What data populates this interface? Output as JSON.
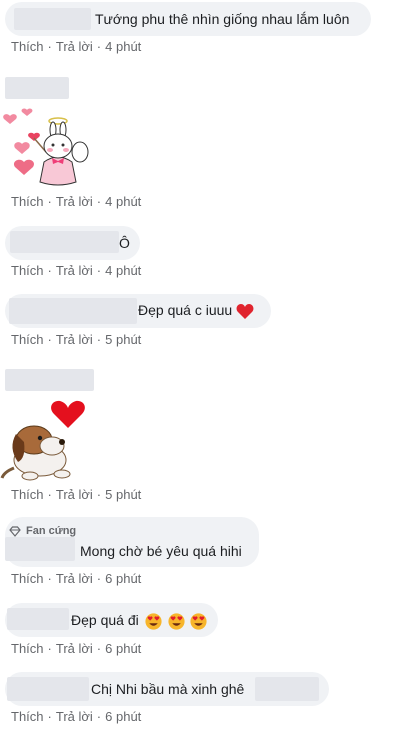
{
  "actions": {
    "like": "Thích",
    "reply": "Trả lời",
    "sep": "·"
  },
  "comments": [
    {
      "text": "Tướng phu thê nhìn giống nhau lắm luôn",
      "time": "4 phút"
    },
    {
      "sticker": "angel-bunny-sticker",
      "time": "4 phút"
    },
    {
      "text": "Ô",
      "time": "4 phút"
    },
    {
      "text": "Đẹp quá c iuuu",
      "emoji": "red-heart",
      "time": "5 phút"
    },
    {
      "sticker": "puppy-heart-sticker",
      "time": "5 phút"
    },
    {
      "badge": "Fan cứng",
      "text": "Mong chờ bé yêu quá hihi",
      "time": "6 phút"
    },
    {
      "text": "Đẹp quá đi",
      "emoji": "heart-eyes x3",
      "time": "6 phút"
    },
    {
      "text": "Chị Nhi bầu mà xinh ghê",
      "time": "6 phút"
    }
  ]
}
